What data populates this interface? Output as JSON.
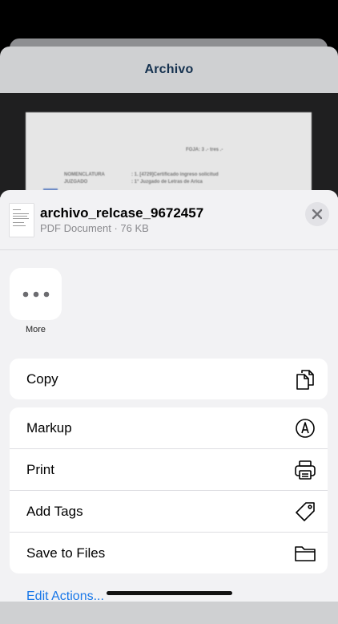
{
  "background": {
    "nav_title": "Archivo",
    "pdf_lines": [
      "FOJA: 3 .- tres .-",
      "NOMENCLATURA",
      ": 1. [4729]Certificado ingreso solicitud",
      "JUZGADO",
      ": 1° Juzgado de Letras de Arica"
    ]
  },
  "share_sheet": {
    "file_name": "archivo_relcase_9672457",
    "file_meta": "PDF Document · 76 KB",
    "more_label": "More",
    "actions_group_1": [
      {
        "label": "Copy",
        "icon": "copy-icon"
      }
    ],
    "actions_group_2": [
      {
        "label": "Markup",
        "icon": "markup-icon"
      },
      {
        "label": "Print",
        "icon": "print-icon"
      },
      {
        "label": "Add Tags",
        "icon": "tag-icon"
      },
      {
        "label": "Save to Files",
        "icon": "folder-icon"
      }
    ],
    "edit_actions_label": "Edit Actions..."
  },
  "colors": {
    "accent": "#1877e8",
    "sheet_bg": "#f2f2f4",
    "nav_title": "#15314f"
  }
}
